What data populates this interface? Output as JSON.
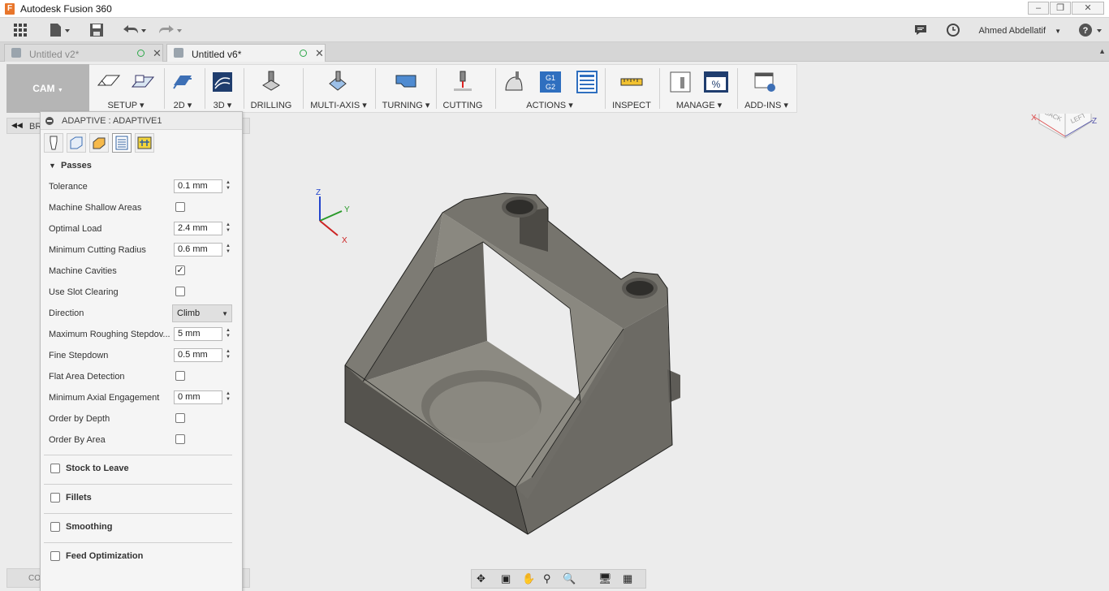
{
  "app": {
    "title": "Autodesk Fusion 360",
    "logo_letter": "F"
  },
  "quick_access": {
    "user": "Ahmed Abdellatif"
  },
  "tabs": [
    {
      "label": "Untitled v2*",
      "active": false
    },
    {
      "label": "Untitled v6*",
      "active": true
    }
  ],
  "ribbon": {
    "workspace": "CAM",
    "groups": [
      {
        "label": "SETUP"
      },
      {
        "label": "2D"
      },
      {
        "label": "3D"
      },
      {
        "label": "DRILLING"
      },
      {
        "label": "MULTI-AXIS"
      },
      {
        "label": "TURNING"
      },
      {
        "label": "CUTTING"
      },
      {
        "label": "ACTIONS"
      },
      {
        "label": "INSPECT"
      },
      {
        "label": "MANAGE"
      },
      {
        "label": "ADD-INS"
      }
    ]
  },
  "browser": {
    "label": "BR",
    "comments_label": "CO"
  },
  "panel": {
    "title": "ADAPTIVE : ADAPTIVE1",
    "section": "Passes",
    "rows": {
      "tolerance": {
        "label": "Tolerance",
        "value": "0.1 mm"
      },
      "machine_shallow": {
        "label": "Machine Shallow Areas",
        "checked": false
      },
      "optimal_load": {
        "label": "Optimal Load",
        "value": "2.4 mm"
      },
      "min_cutting_radius": {
        "label": "Minimum Cutting Radius",
        "value": "0.6 mm"
      },
      "machine_cavities": {
        "label": "Machine Cavities",
        "checked": true
      },
      "use_slot_clearing": {
        "label": "Use Slot Clearing",
        "checked": false
      },
      "direction": {
        "label": "Direction",
        "value": "Climb"
      },
      "max_roughing_stepdown": {
        "label": "Maximum Roughing Stepdov...",
        "value": "5 mm"
      },
      "fine_stepdown": {
        "label": "Fine Stepdown",
        "value": "0.5 mm"
      },
      "flat_area_detection": {
        "label": "Flat Area Detection",
        "checked": false
      },
      "min_axial_engagement": {
        "label": "Minimum Axial Engagement",
        "value": "0 mm"
      },
      "order_by_depth": {
        "label": "Order by Depth",
        "checked": false
      },
      "order_by_area": {
        "label": "Order By Area",
        "checked": false
      }
    },
    "groups": [
      {
        "label": "Stock to Leave"
      },
      {
        "label": "Fillets"
      },
      {
        "label": "Smoothing"
      },
      {
        "label": "Feed Optimization"
      }
    ]
  },
  "viewcube": {
    "left": "LEFT",
    "back": "BACK"
  },
  "axes": {
    "x": "X",
    "y": "Y",
    "z": "Z"
  }
}
